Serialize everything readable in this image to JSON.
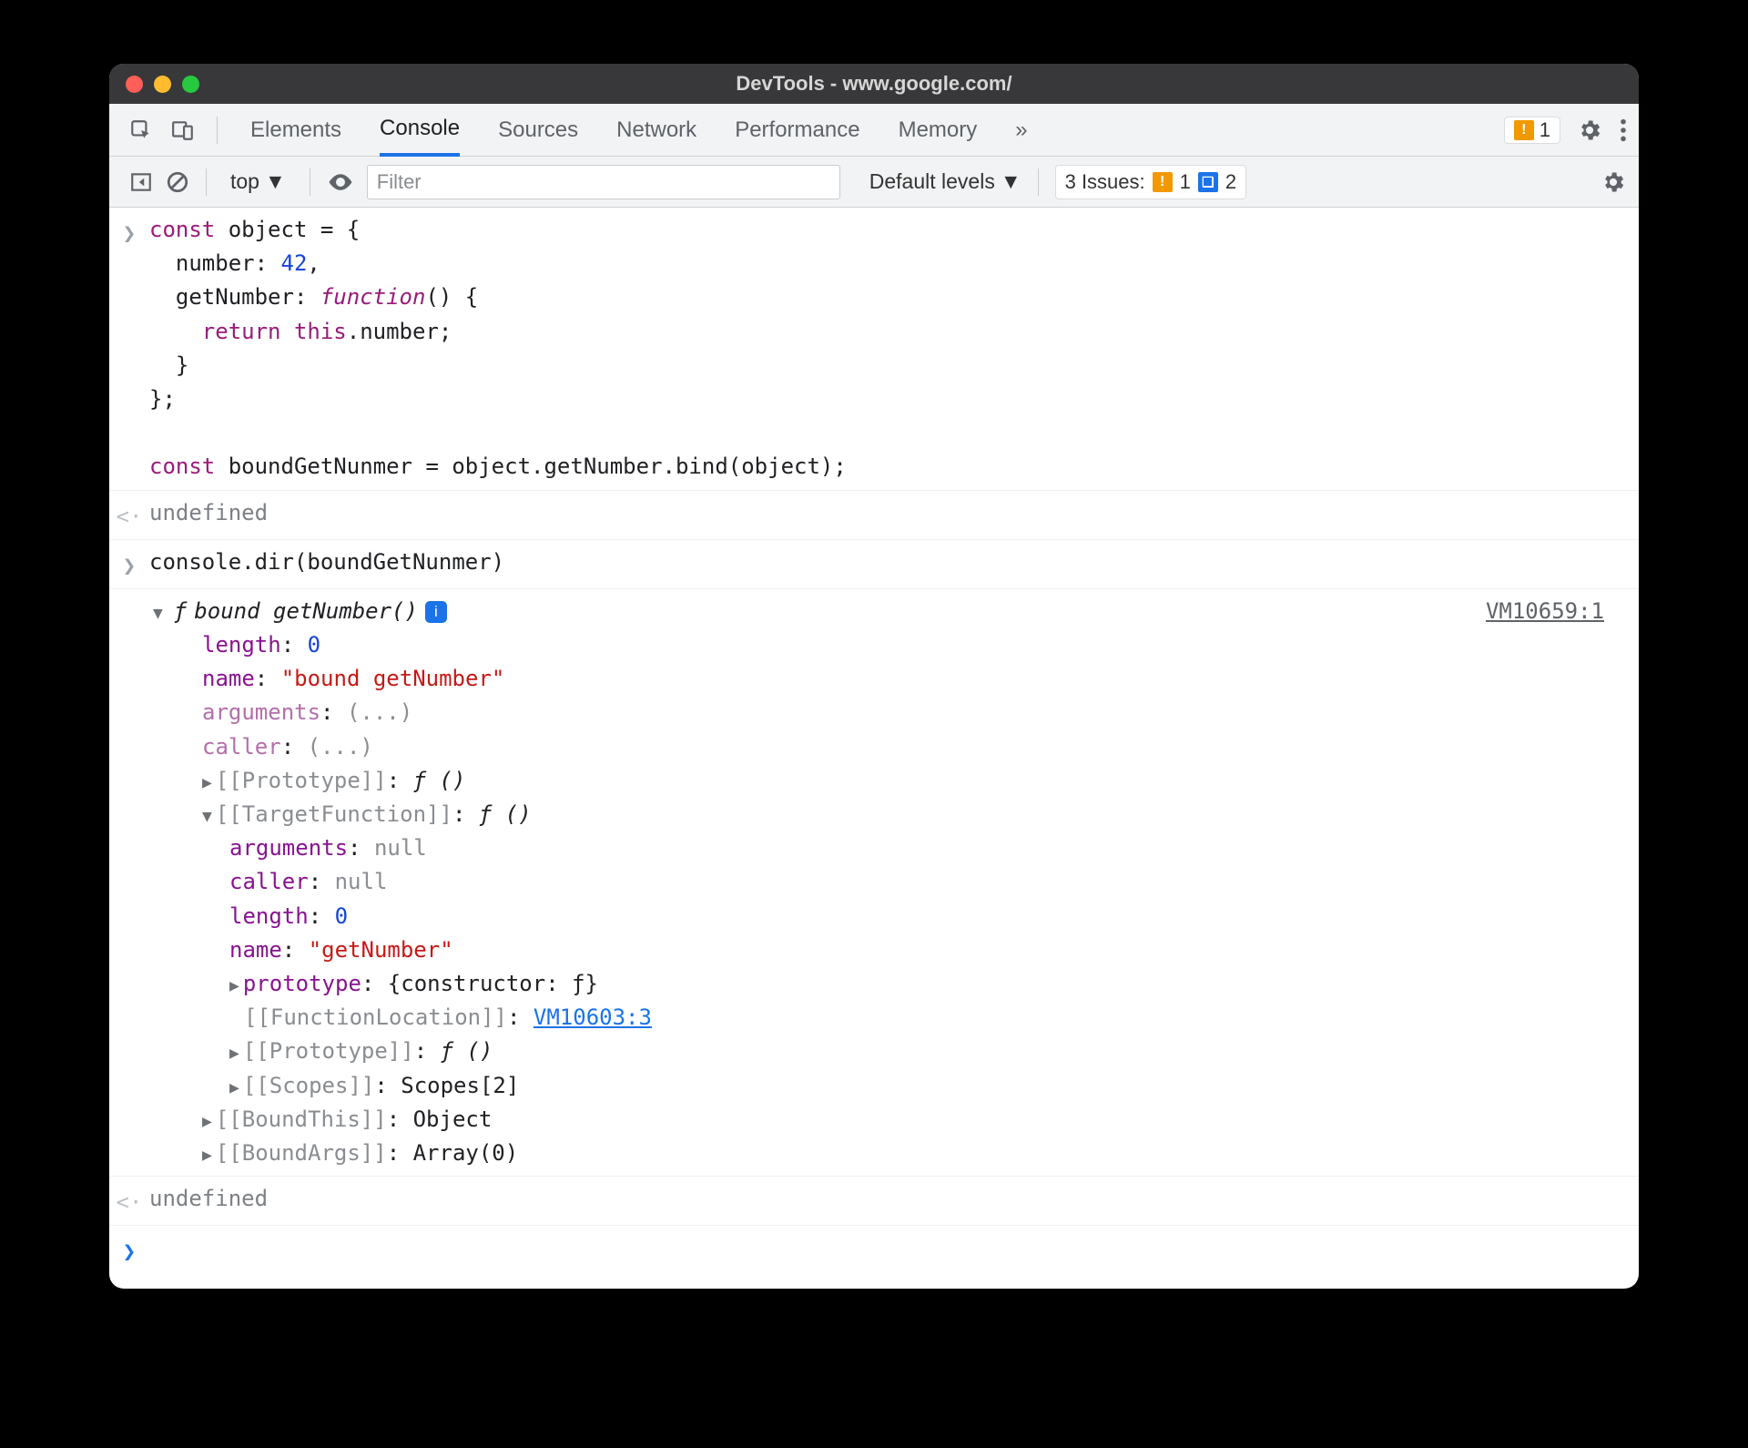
{
  "window": {
    "title": "DevTools - www.google.com/"
  },
  "tabs": {
    "items": [
      "Elements",
      "Console",
      "Sources",
      "Network",
      "Performance",
      "Memory"
    ],
    "active": "Console"
  },
  "warn_count": "1",
  "toolbar": {
    "context": "top",
    "filter_placeholder": "Filter",
    "levels": "Default levels",
    "issues_label": "3 Issues:",
    "issues_warn": "1",
    "issues_info": "2"
  },
  "entries": {
    "code1": "const object = {\n  number: 42,\n  getNumber: function() {\n    return this.number;\n  }\n};\n\n",
    "code1b": "const boundGetNunmer = object.getNumber.bind(object);",
    "res1": "undefined",
    "code2": "console.dir(boundGetNunmer)",
    "obj": {
      "source_link": "VM10659:1",
      "header_prefix": "ƒ",
      "header_name": "bound getNumber()",
      "length_key": "length",
      "length_val": "0",
      "name_key": "name",
      "name_val": "\"bound getNumber\"",
      "arguments_key": "arguments",
      "ellipsis": "(...)",
      "caller_key": "caller",
      "proto_key": "[[Prototype]]",
      "f_empty": "ƒ ()",
      "target_key": "[[TargetFunction]]",
      "tf_arguments_key": "arguments",
      "null": "null",
      "tf_caller_key": "caller",
      "tf_length_key": "length",
      "tf_length_val": "0",
      "tf_name_key": "name",
      "tf_name_val": "\"getNumber\"",
      "tf_proto_key": "prototype",
      "tf_proto_val": "{constructor: ƒ}",
      "tf_loc_key": "[[FunctionLocation]]",
      "tf_loc_val": "VM10603:3",
      "tf_proto2_key": "[[Prototype]]",
      "tf_scopes_key": "[[Scopes]]",
      "tf_scopes_val": "Scopes[2]",
      "boundthis_key": "[[BoundThis]]",
      "boundthis_val": "Object",
      "boundargs_key": "[[BoundArgs]]",
      "boundargs_val": "Array(0)"
    },
    "res2": "undefined"
  }
}
